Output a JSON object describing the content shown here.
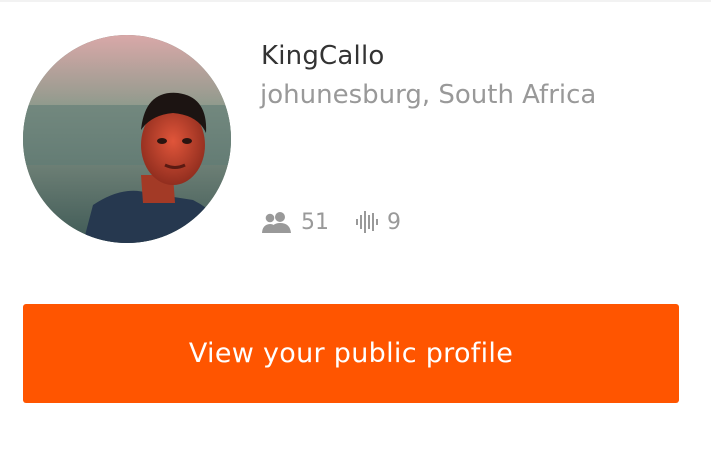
{
  "profile": {
    "username": "KingCallo",
    "location": "johunesburg, South Africa",
    "followers_count": "51",
    "tracks_count": "9",
    "followers_icon": "followers-icon",
    "tracks_icon": "sound-wave-icon"
  },
  "actions": {
    "view_profile_label": "View your public profile"
  },
  "colors": {
    "accent": "#ff5500",
    "primary_text": "#333333",
    "secondary_text": "#999999"
  }
}
